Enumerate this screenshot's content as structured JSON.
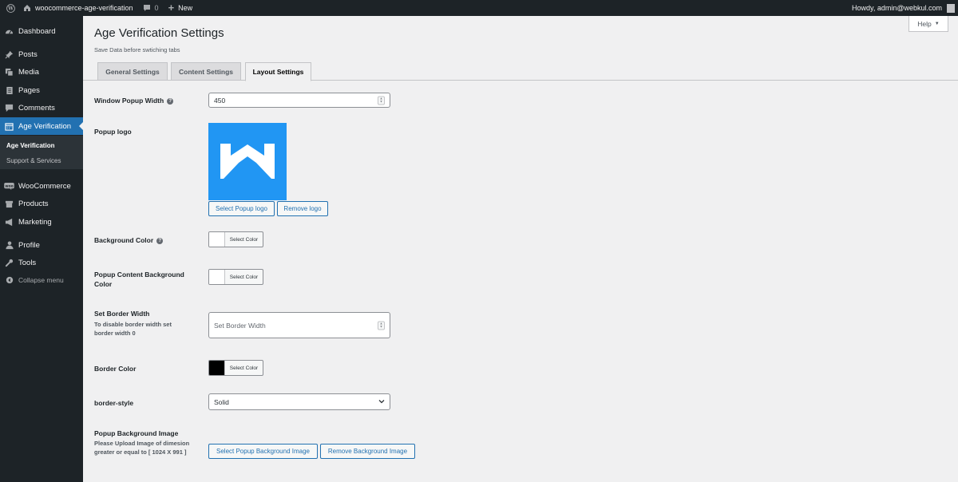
{
  "adminbar": {
    "site_name": "woocommerce-age-verification",
    "comments_count": "0",
    "new_label": "New",
    "howdy": "Howdy, admin@webkul.com"
  },
  "sidebar": {
    "items": [
      {
        "label": "Dashboard",
        "icon": "dashboard-icon"
      },
      {
        "label": "Posts",
        "icon": "pin-icon"
      },
      {
        "label": "Media",
        "icon": "media-icon"
      },
      {
        "label": "Pages",
        "icon": "page-icon"
      },
      {
        "label": "Comments",
        "icon": "comment-icon"
      },
      {
        "label": "Age Verification",
        "icon": "calendar-icon",
        "current": true
      },
      {
        "label": "WooCommerce",
        "icon": "woo-icon"
      },
      {
        "label": "Products",
        "icon": "archive-icon"
      },
      {
        "label": "Marketing",
        "icon": "megaphone-icon"
      },
      {
        "label": "Profile",
        "icon": "user-icon"
      },
      {
        "label": "Tools",
        "icon": "wrench-icon"
      },
      {
        "label": "Collapse menu",
        "icon": "collapse-icon"
      }
    ],
    "submenu": [
      "Age Verification",
      "Support & Services"
    ]
  },
  "header": {
    "help_label": "Help",
    "title": "Age Verification Settings",
    "subtitle": "Save Data before swtiching tabs"
  },
  "tabs": [
    "General Settings",
    "Content Settings",
    "Layout Settings"
  ],
  "active_tab": "Layout Settings",
  "form": {
    "popup_width": {
      "label": "Window Popup Width",
      "value": "450"
    },
    "popup_logo": {
      "label": "Popup logo",
      "select_label": "Select Popup logo",
      "remove_label": "Remove logo"
    },
    "bg_color": {
      "label": "Background Color",
      "button_label": "Select Color",
      "swatch": "#ffffff"
    },
    "content_bg_color": {
      "label": "Popup Content Background Color",
      "button_label": "Select Color",
      "swatch": "#ffffff"
    },
    "border_width": {
      "label": "Set Border Width",
      "note": "To disable border width set border width 0",
      "placeholder": "Set Border Width"
    },
    "border_color": {
      "label": "Border Color",
      "button_label": "Select Color",
      "swatch": "#000000"
    },
    "border_style": {
      "label": "border-style",
      "value": "Solid"
    },
    "bg_image": {
      "label": "Popup Background Image",
      "note": "Please Upload Image of dimesion greater or equal to [ 1024 X 991 ]",
      "select_label": "Select Popup Background Image",
      "remove_label": "Remove Background Image"
    }
  },
  "colors": {
    "accent": "#2271b1",
    "logo_bg": "#2196f3",
    "admin_dark": "#1d2327"
  }
}
